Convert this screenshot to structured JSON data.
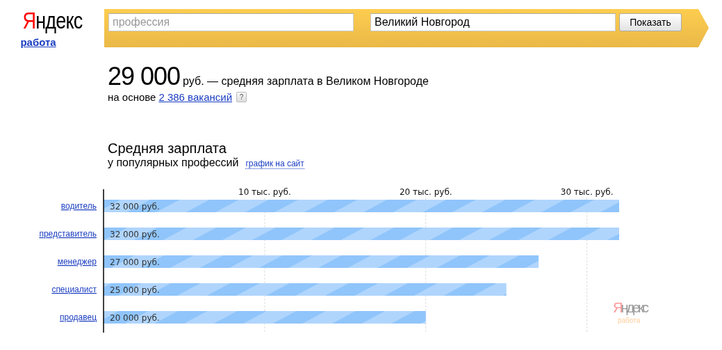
{
  "logo": {
    "first": "Я",
    "rest": "ндекс",
    "service": "работа"
  },
  "search": {
    "profession": {
      "placeholder": "профессия"
    },
    "city": {
      "value": "Великий Новгород"
    },
    "button": "Показать"
  },
  "summary": {
    "amount": "29 000",
    "text": "руб. — средняя зарплата в Великом Новгороде",
    "basis": "на основе",
    "vacancies_link": "2 386 вакансий",
    "help": "?"
  },
  "chart_section": {
    "title": "Средняя зарплата",
    "subtitle": "у популярных профессий",
    "embed_link": "график на сайт",
    "chart_logo": {
      "first": "Я",
      "rest": "ндекс",
      "service": "работа"
    },
    "chart_data": {
      "type": "bar",
      "orientation": "horizontal",
      "categories": [
        "водитель",
        "представитель",
        "менеджер",
        "специалист",
        "продавец"
      ],
      "series": [
        {
          "color": "#90c5fb",
          "values": [
            32,
            32,
            27,
            25,
            20
          ]
        }
      ],
      "value_labels": [
        "32 000 руб.",
        "32 000 руб.",
        "27 000 руб.",
        "25 000 руб.",
        "20 000 руб."
      ],
      "xlim": [
        0,
        32
      ],
      "grid": true,
      "xticks": [
        {
          "value": 10,
          "label": "10 тыс. руб."
        },
        {
          "value": 20,
          "label": "20 тыс. руб."
        },
        {
          "value": 30,
          "label": "30 тыс. руб."
        }
      ]
    }
  }
}
